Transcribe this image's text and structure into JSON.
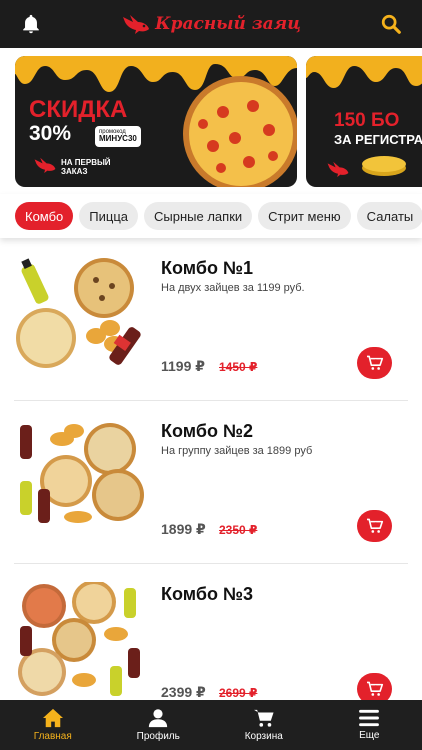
{
  "header": {
    "logo_text": "Красный заяц",
    "notification_icon": "bell-icon",
    "search_icon": "search-icon"
  },
  "banners": [
    {
      "title": "СКИДКА",
      "discount": "30%",
      "promo_label": "промокод",
      "promo_code": "МИНУС30",
      "footer_line1": "НА ПЕРВЫЙ",
      "footer_line2": "ЗАКАЗ"
    },
    {
      "title": "150 БО",
      "subtitle": "ЗА РЕГИСТРАЦ"
    }
  ],
  "categories": [
    "Комбо",
    "Пицца",
    "Сырные лапки",
    "Стрит меню",
    "Салаты"
  ],
  "active_category": "Комбо",
  "products": [
    {
      "name": "Комбо №1",
      "description": "На двух зайцев за 1199 руб.",
      "price": "1199 ₽",
      "old_price": "1450 ₽"
    },
    {
      "name": "Комбо №2",
      "description": "На группу зайцев за 1899 руб",
      "price": "1899 ₽",
      "old_price": "2350 ₽"
    },
    {
      "name": "Комбо №3",
      "description": "",
      "price": "2399 ₽",
      "old_price": "2699 ₽"
    }
  ],
  "nav": [
    {
      "label": "Главная",
      "icon": "home-icon"
    },
    {
      "label": "Профиль",
      "icon": "profile-icon"
    },
    {
      "label": "Корзина",
      "icon": "cart-icon"
    },
    {
      "label": "Еще",
      "icon": "menu-icon"
    }
  ],
  "colors": {
    "accent": "#e3212b",
    "header_bg": "#1c1c1c",
    "nav_active": "#f5b21c",
    "nav_bg": "#1f1f1f"
  }
}
